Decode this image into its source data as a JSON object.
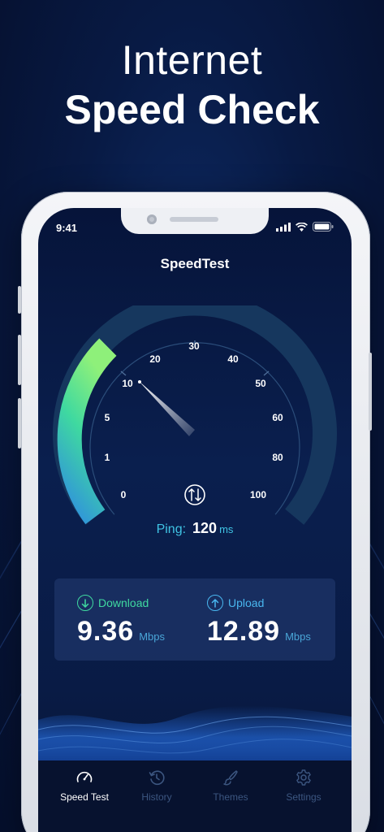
{
  "headline": {
    "line1": "Internet",
    "line2": "Speed Check"
  },
  "status_bar": {
    "time": "9:41"
  },
  "app": {
    "title": "SpeedTest"
  },
  "gauge": {
    "tick_labels": [
      "0",
      "1",
      "5",
      "10",
      "20",
      "30",
      "40",
      "50",
      "60",
      "80",
      "100"
    ],
    "needle_value": 10,
    "swap_icon": "swap-arrows-icon",
    "accent_gradient": [
      "#2f8ee0",
      "#3fd9a0",
      "#8ef07a"
    ],
    "track_color": "#16375e"
  },
  "ping": {
    "label": "Ping:",
    "value": "120",
    "unit": "ms"
  },
  "results": {
    "download": {
      "label": "Download",
      "value": "9.36",
      "unit": "Mbps",
      "icon": "arrow-down-circle-icon",
      "color": "#3fd9a0"
    },
    "upload": {
      "label": "Upload",
      "value": "12.89",
      "unit": "Mbps",
      "icon": "arrow-up-circle-icon",
      "color": "#49b7ef"
    }
  },
  "tabs": [
    {
      "label": "Speed Test",
      "icon": "speedometer-icon",
      "active": true
    },
    {
      "label": "History",
      "icon": "history-icon",
      "active": false
    },
    {
      "label": "Themes",
      "icon": "brush-icon",
      "active": false
    },
    {
      "label": "Settings",
      "icon": "gear-icon",
      "active": false
    }
  ]
}
